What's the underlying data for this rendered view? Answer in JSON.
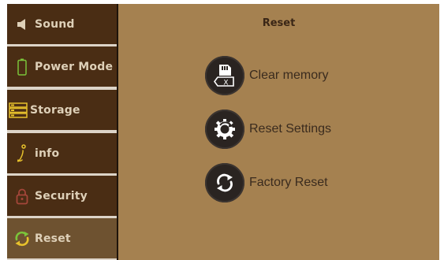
{
  "header": {
    "title": "Reset"
  },
  "sidebar": {
    "items": [
      {
        "label": "Sound",
        "icon": "speaker-icon"
      },
      {
        "label": "Power Mode",
        "icon": "battery-icon"
      },
      {
        "label": "Storage",
        "icon": "storage-icon"
      },
      {
        "label": "info",
        "icon": "info-icon"
      },
      {
        "label": "Security",
        "icon": "lock-icon"
      },
      {
        "label": "Reset",
        "icon": "refresh-icon",
        "active": true
      }
    ]
  },
  "actions": [
    {
      "label": "Clear memory",
      "icon": "sd-card-clear-icon"
    },
    {
      "label": "Reset Settings",
      "icon": "gear-reset-icon"
    },
    {
      "label": "Factory Reset",
      "icon": "refresh-icon"
    }
  ],
  "colors": {
    "sidebar_bg": "#4a2d14",
    "sidebar_active_bg": "#6e5230",
    "content_bg": "#a58150",
    "icon_circle": "#2a2421",
    "battery_green": "#7bc43a",
    "storage_yellow": "#e8c22c",
    "info_yellow": "#e8c22c",
    "lock_red": "#a4463a",
    "refresh_green": "#7bc43a",
    "refresh_yellow": "#e8c22c"
  }
}
